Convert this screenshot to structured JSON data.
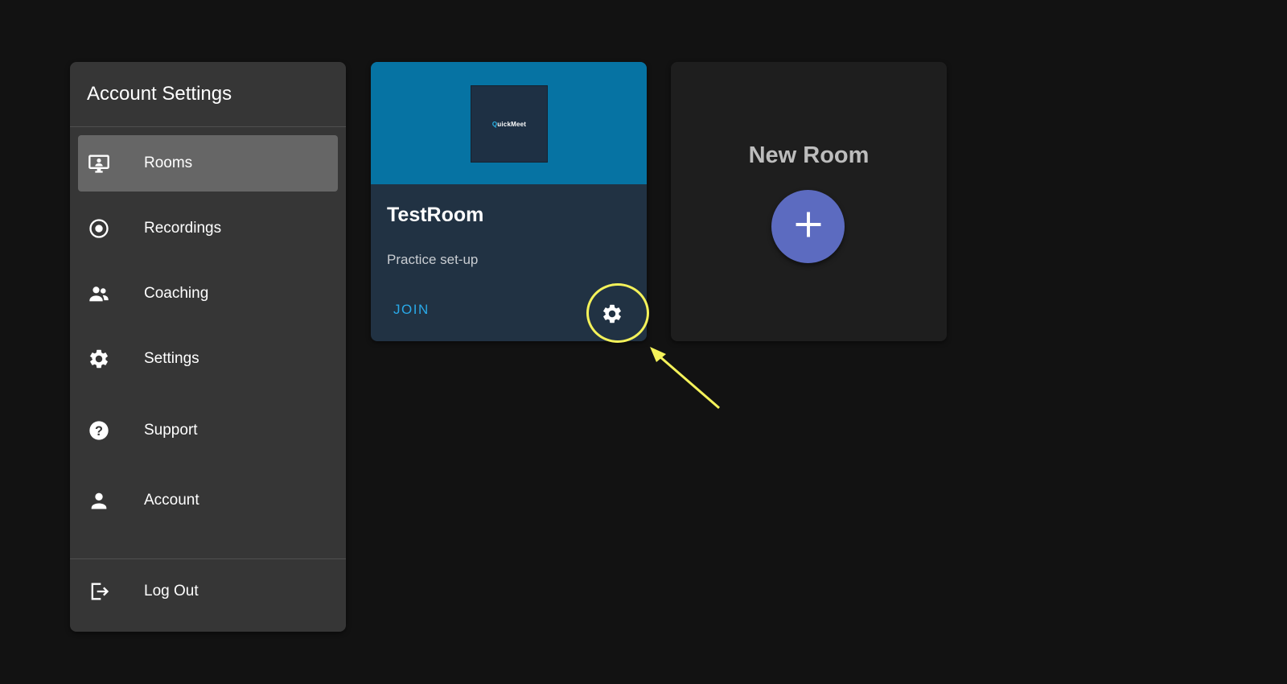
{
  "sidebar": {
    "title": "Account Settings",
    "items": [
      {
        "label": "Rooms",
        "icon": "monitor-user-icon",
        "active": true
      },
      {
        "label": "Recordings",
        "icon": "record-icon",
        "active": false
      },
      {
        "label": "Coaching",
        "icon": "people-icon",
        "active": false
      },
      {
        "label": "Settings",
        "icon": "gear-icon",
        "active": false
      },
      {
        "label": "Support",
        "icon": "help-icon",
        "active": false
      },
      {
        "label": "Account",
        "icon": "person-icon",
        "active": false
      }
    ],
    "logout": {
      "label": "Log Out",
      "icon": "logout-icon"
    }
  },
  "room_card": {
    "logo": {
      "prefix": "Q",
      "text": "uickMeet"
    },
    "title": "TestRoom",
    "description": "Practice set-up",
    "join_label": "JOIN",
    "settings_icon": "gear-icon"
  },
  "new_room": {
    "title": "New Room",
    "add_icon": "plus-icon"
  },
  "colors": {
    "background": "#121212",
    "sidebar": "#363636",
    "active_item": "#666666",
    "card_media": "#0673a3",
    "card_body": "#213243",
    "join_text": "#29a9e8",
    "add_button": "#5c6bc0",
    "annotation": "#f4f25a"
  }
}
